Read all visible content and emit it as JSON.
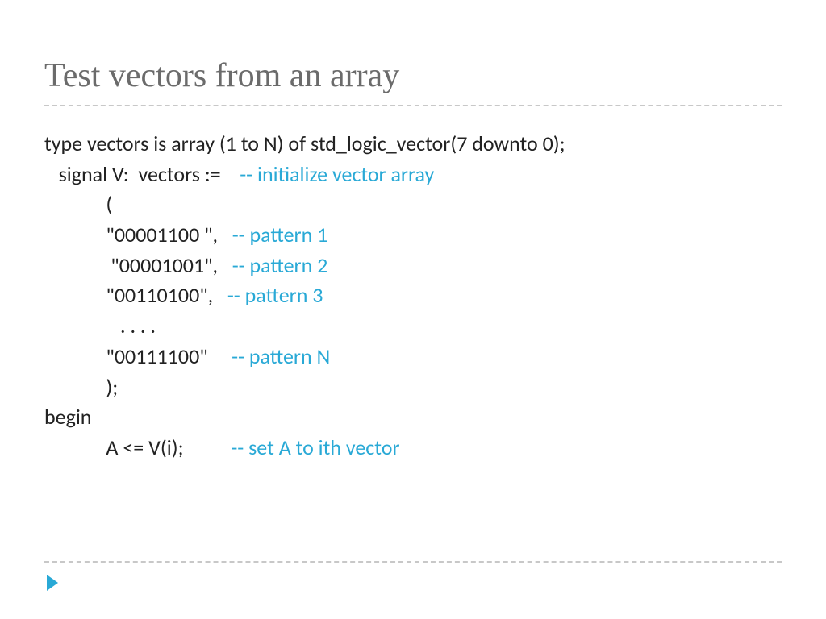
{
  "title": "Test vectors from an array",
  "code": {
    "l1": "type vectors is array (1 to N) of std_logic_vector(7 downto 0);",
    "l2a": "   signal V:  vectors :=    ",
    "l2b": "-- initialize vector array",
    "l3": "             (",
    "l4a": "             \"00001100 \",   ",
    "l4b": "-- pattern 1",
    "l5a": "              \"00001001\",   ",
    "l5b": "-- pattern 2",
    "l6a": "             \"00110100\",   ",
    "l6b": "-- pattern 3",
    "l7": "                . . . .",
    "l8a": "             \"00111100\"     ",
    "l8b": "-- pattern N",
    "l9": "             );",
    "l10": "",
    "l11": "begin",
    "l12a": "             A <= V(i);          ",
    "l12b": "-- set A to ith vector"
  },
  "colors": {
    "comment": "#29a9d6",
    "title": "#6b6b6b"
  }
}
